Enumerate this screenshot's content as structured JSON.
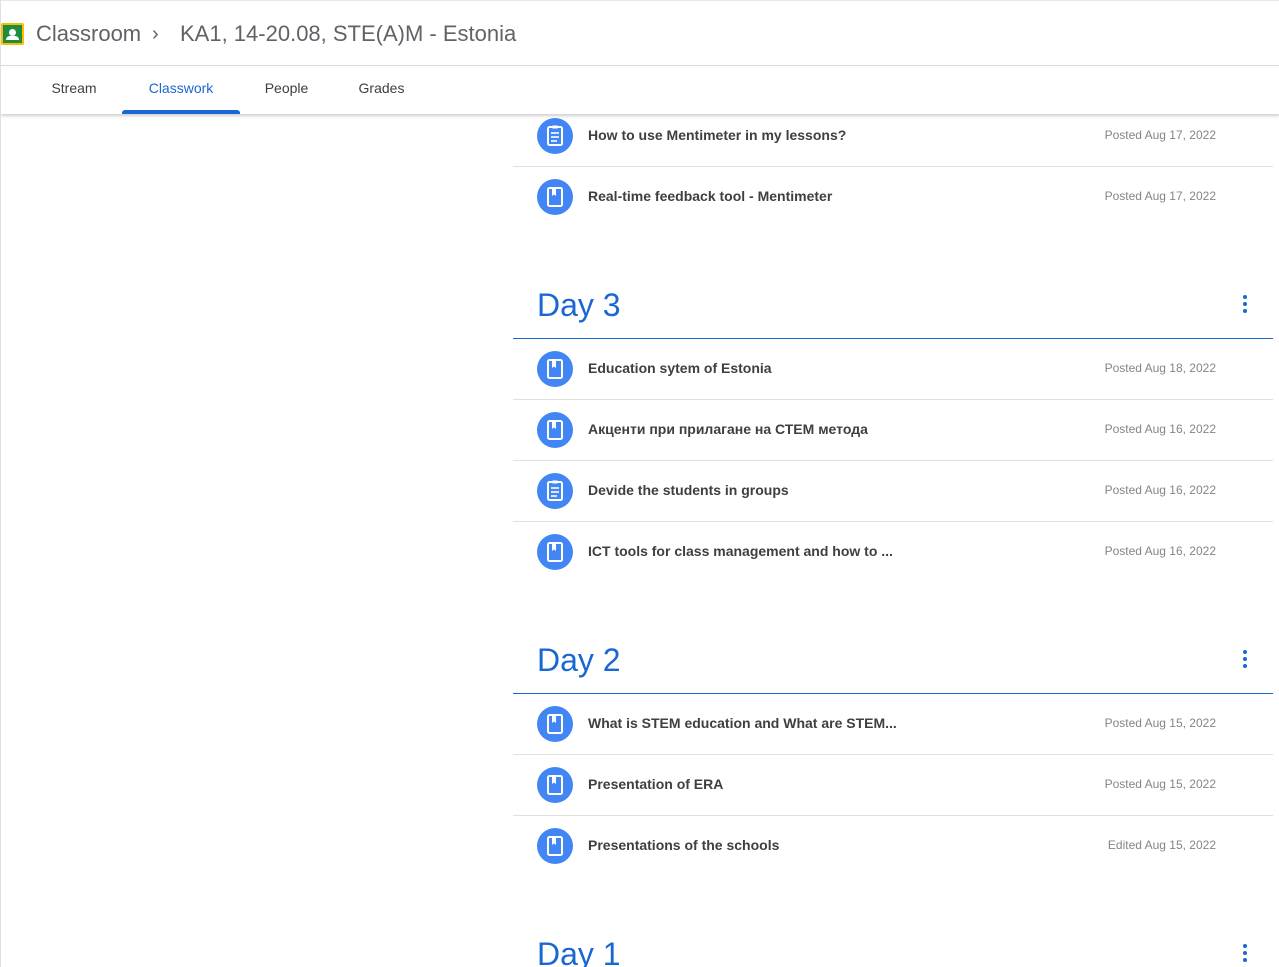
{
  "header": {
    "app_name": "Classroom",
    "separator": "›",
    "class_name": "KA1, 14-20.08, STE(A)M - Estonia"
  },
  "tabs": [
    {
      "label": "Stream",
      "active": false
    },
    {
      "label": "Classwork",
      "active": true
    },
    {
      "label": "People",
      "active": false
    },
    {
      "label": "Grades",
      "active": false
    }
  ],
  "colors": {
    "accent": "#1967d2",
    "icon_bg": "#4285f4",
    "logo": "#1e8e3e"
  },
  "top_items": [
    {
      "icon": "assignment-icon",
      "title": "How to use Mentimeter in my lessons?",
      "date": "Posted Aug 17, 2022"
    },
    {
      "icon": "material-icon",
      "title": "Real-time feedback tool - Mentimeter",
      "date": "Posted Aug 17, 2022"
    }
  ],
  "topics": [
    {
      "title": "Day 3",
      "items": [
        {
          "icon": "material-icon",
          "title": "Education sytem of Estonia",
          "date": "Posted Aug 18, 2022"
        },
        {
          "icon": "material-icon",
          "title": "Акценти при прилагане на СТЕМ метода",
          "date": "Posted Aug 16, 2022"
        },
        {
          "icon": "assignment-icon",
          "title": "Devide the students in groups",
          "date": "Posted Aug 16, 2022"
        },
        {
          "icon": "material-icon",
          "title": "ICT tools for class management and how to ...",
          "date": "Posted Aug 16, 2022"
        }
      ]
    },
    {
      "title": "Day 2",
      "items": [
        {
          "icon": "material-icon",
          "title": "What is STEM education and What are STEM...",
          "date": "Posted Aug 15, 2022"
        },
        {
          "icon": "material-icon",
          "title": "Presentation of ERA",
          "date": "Posted Aug 15, 2022"
        },
        {
          "icon": "material-icon",
          "title": "Presentations of the schools",
          "date": "Edited Aug 15, 2022"
        }
      ]
    },
    {
      "title": "Day 1",
      "items": []
    }
  ]
}
